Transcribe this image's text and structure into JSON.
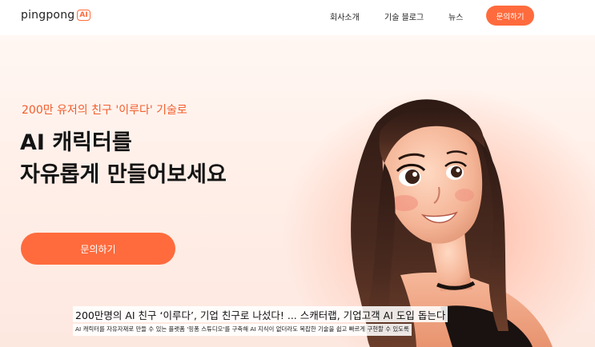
{
  "header": {
    "logo_text": "pingpong",
    "logo_badge": "AI",
    "nav": [
      "회사소개",
      "기술 블로그",
      "뉴스"
    ],
    "cta_label": "문의하기"
  },
  "hero": {
    "eyebrow": "200만 유저의 친구 '이루다' 기술로",
    "headline_line1": "AI 캐릭터를",
    "headline_line2": "자유롭게 만들어보세요",
    "cta_label": "문의하기"
  },
  "caption": {
    "title": "200만명의 AI 친구 ‘이루다’, 기업 친구로 나섰다! ... 스캐터랩, 기업고객 AI 도입 돕는다",
    "subtitle": "AI 캐릭터를 자유자재로 만들 수 있는 플랫폼 '핑퐁 스튜디오'를 구축해 AI 지식이 없더라도 복잡한 기술을 쉽고 빠르게 구현할 수 있도록"
  },
  "colors": {
    "accent": "#ff6b3d",
    "eyebrow": "#f25d2b",
    "headline": "#141414"
  }
}
